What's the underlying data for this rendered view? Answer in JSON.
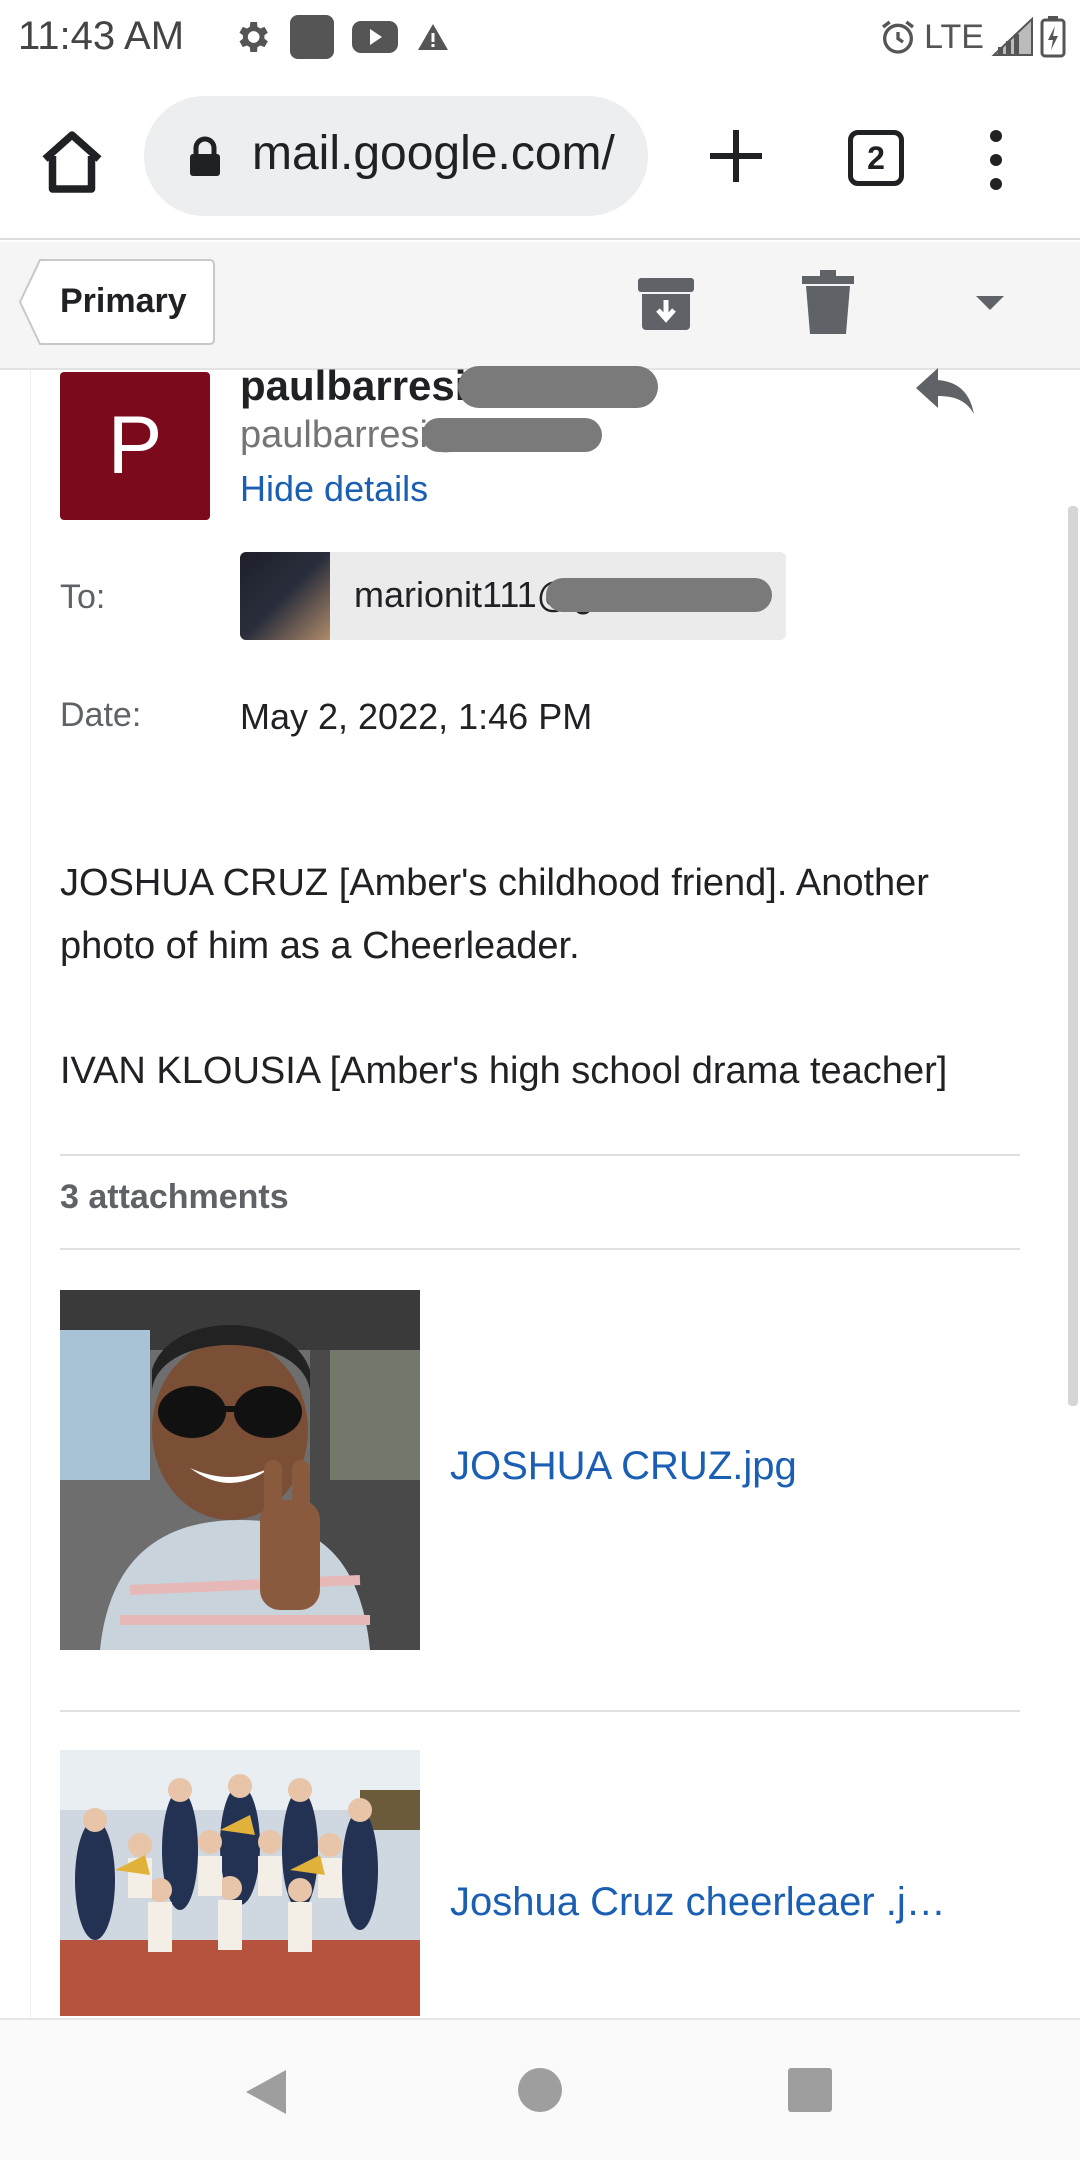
{
  "status_bar": {
    "time": "11:43 AM",
    "network": "LTE"
  },
  "browser": {
    "url": "mail.google.com/",
    "tab_count": "2"
  },
  "gmail_header": {
    "back_label": "Primary"
  },
  "email": {
    "sender_name": "paulbarresi@",
    "sender_email": "paulbarresi@",
    "hide_details": "Hide details",
    "to_label": "To:",
    "to_value": "marionit111@g",
    "date_label": "Date:",
    "date_value": "May 2, 2022, 1:46 PM",
    "body_line1": "JOSHUA CRUZ [Amber's childhood friend]. Another photo of him as a Cheerleader.",
    "body_line2": "IVAN KLOUSIA [Amber's high school drama teacher]"
  },
  "attachments": {
    "count_label": "3 attachments",
    "items": [
      {
        "name": "JOSHUA CRUZ.jpg"
      },
      {
        "name": "Joshua Cruz cheerleaer .j…"
      }
    ]
  },
  "colors": {
    "avatar_bg": "#7b0b1c",
    "link": "#1a5fb4"
  }
}
